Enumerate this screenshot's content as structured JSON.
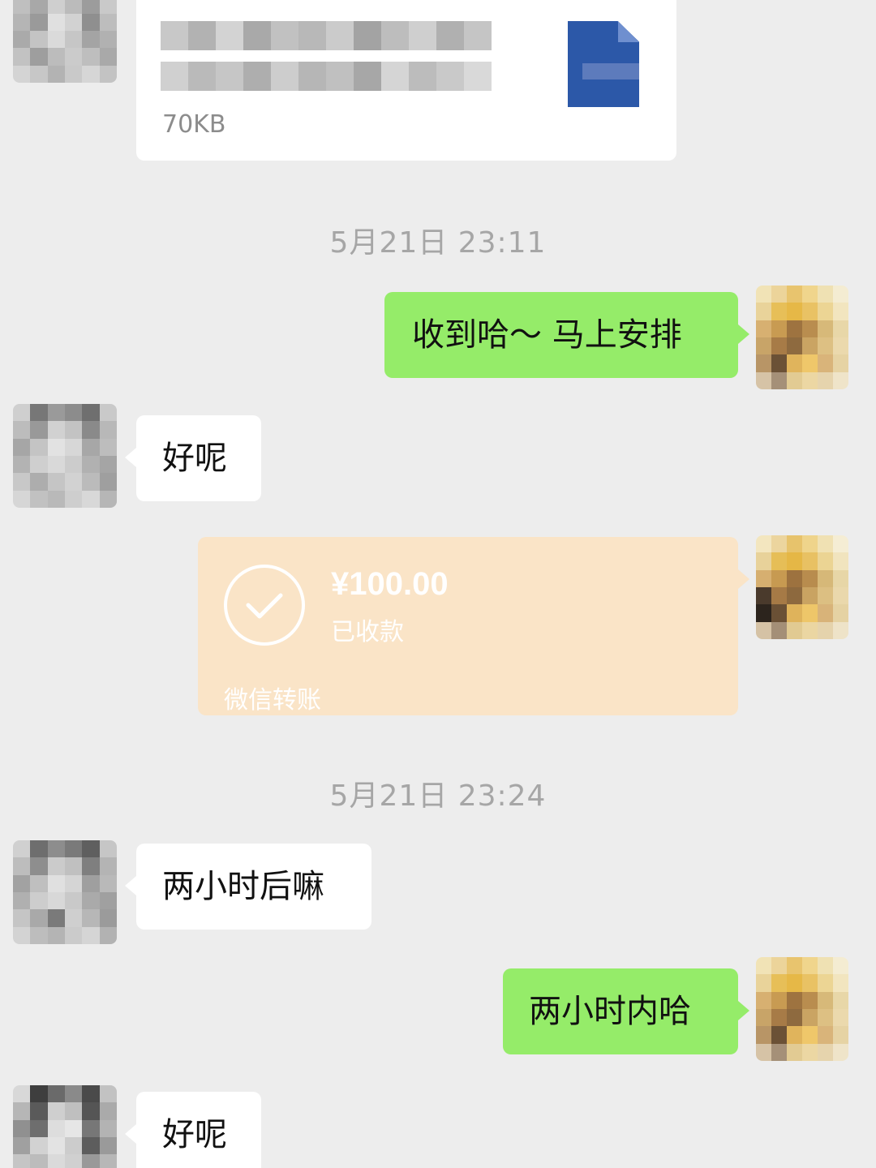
{
  "file_message": {
    "size": "70KB"
  },
  "timestamps": [
    "5月21日 23:11",
    "5月21日 23:24"
  ],
  "messages": [
    {
      "side": "out",
      "text": "收到哈～ 马上安排"
    },
    {
      "side": "in",
      "text": "好呢"
    },
    {
      "side": "in",
      "text": "两小时后嘛"
    },
    {
      "side": "out",
      "text": "两小时内哈"
    },
    {
      "side": "in",
      "text": "好呢"
    }
  ],
  "transfer": {
    "amount": "¥100.00",
    "status": "已收款",
    "label": "微信转账",
    "icon": "check-circle-icon"
  },
  "colors": {
    "background": "#ededed",
    "outgoing_bubble": "#95ec69",
    "incoming_bubble": "#ffffff",
    "transfer_card": "#fae4c7",
    "timestamp_text": "#a6a6a6",
    "file_icon": "#2c58a8"
  }
}
